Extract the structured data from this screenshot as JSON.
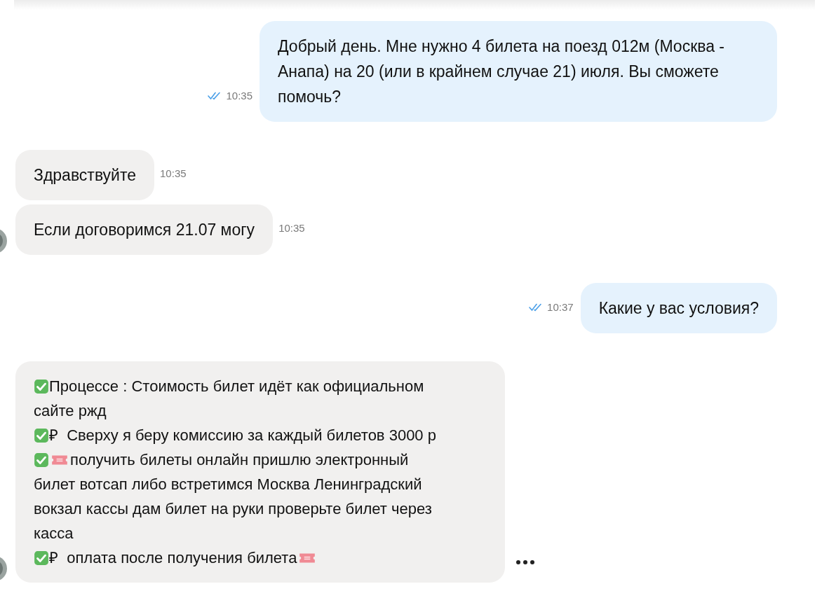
{
  "messages": [
    {
      "kind": "outgoing",
      "text": "Добрый день. Мне нужно 4 билета на поезд 012м (Москва - Анапа) на 20 (или в крайнем случае 21) июля. Вы сможете помочь?",
      "time": "10:35",
      "read": true
    },
    {
      "kind": "incoming",
      "text": "Здравствуйте",
      "time": "10:35",
      "avatar": false
    },
    {
      "kind": "incoming",
      "text": "Если договоримся 21.07 могу",
      "time": "10:35",
      "avatar": true
    },
    {
      "kind": "outgoing",
      "text": "Какие у вас условия?",
      "time": "10:37",
      "read": true
    },
    {
      "kind": "incoming",
      "avatar": true,
      "more": true,
      "lines": [
        {
          "parts": [
            {
              "kind": "check"
            },
            {
              "kind": "text",
              "text": "Процессе : Стоимость билет идёт как официальном"
            }
          ]
        },
        {
          "parts": [
            {
              "kind": "text",
              "text": "сайте ржд"
            }
          ]
        },
        {
          "parts": [
            {
              "kind": "check"
            },
            {
              "kind": "text",
              "text": "₽  Сверху я беру комиссию за каждый билетов 3000 р"
            }
          ]
        },
        {
          "parts": [
            {
              "kind": "check"
            },
            {
              "kind": "ticket"
            },
            {
              "kind": "text",
              "text": "получить билеты онлайн пришлю электронный"
            }
          ]
        },
        {
          "parts": [
            {
              "kind": "text",
              "text": "билет вотсап либо встретимся Москва Ленинградский"
            }
          ]
        },
        {
          "parts": [
            {
              "kind": "text",
              "text": "вокзал кассы дам билет на руки проверьте билет через"
            }
          ]
        },
        {
          "parts": [
            {
              "kind": "text",
              "text": "касса"
            }
          ]
        },
        {
          "parts": [
            {
              "kind": "check"
            },
            {
              "kind": "text",
              "text": "₽  оплата после получения билета"
            },
            {
              "kind": "ticket"
            }
          ]
        }
      ]
    }
  ]
}
